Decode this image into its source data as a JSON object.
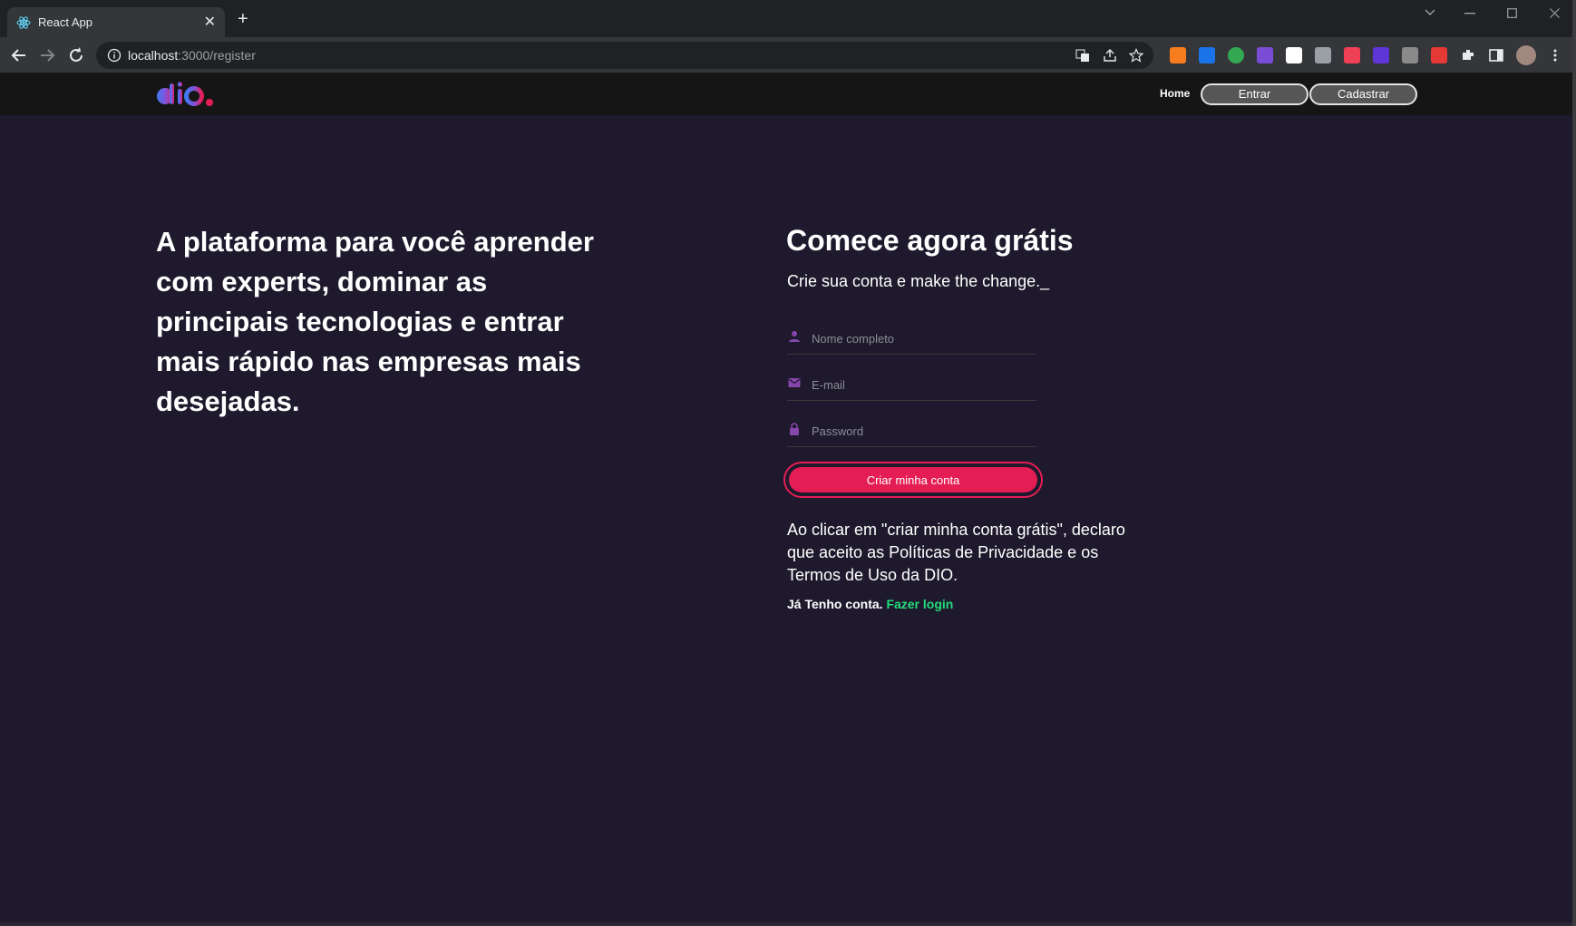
{
  "browser": {
    "tab_title": "React App",
    "url_host": "localhost",
    "url_path": ":3000/register",
    "new_tab_glyph": "+",
    "tab_close_glyph": "✕"
  },
  "header": {
    "logo_alt": "dio.",
    "nav_home": "Home",
    "btn_login": "Entrar",
    "btn_register": "Cadastrar"
  },
  "hero": {
    "text": "A plataforma para você aprender com experts, dominar as principais tecnologias e entrar mais rápido nas empresas mais desejadas."
  },
  "form": {
    "title": "Comece agora grátis",
    "subtitle": "Crie sua conta e make the change._",
    "name_placeholder": "Nome completo",
    "email_placeholder": "E-mail",
    "password_placeholder": "Password",
    "submit_label": "Criar minha conta",
    "terms": "Ao clicar em \"criar minha conta grátis\", declaro que aceito as Políticas de Privacidade e os Termos de Uso da DIO.",
    "have_account": "Já Tenho conta.",
    "login_link": "Fazer login"
  },
  "colors": {
    "page_bg": "#1e192c",
    "header_bg": "#151515",
    "accent_pink": "#e41d54",
    "link_green": "#23dd7a",
    "icon_purple": "#8647ad"
  }
}
